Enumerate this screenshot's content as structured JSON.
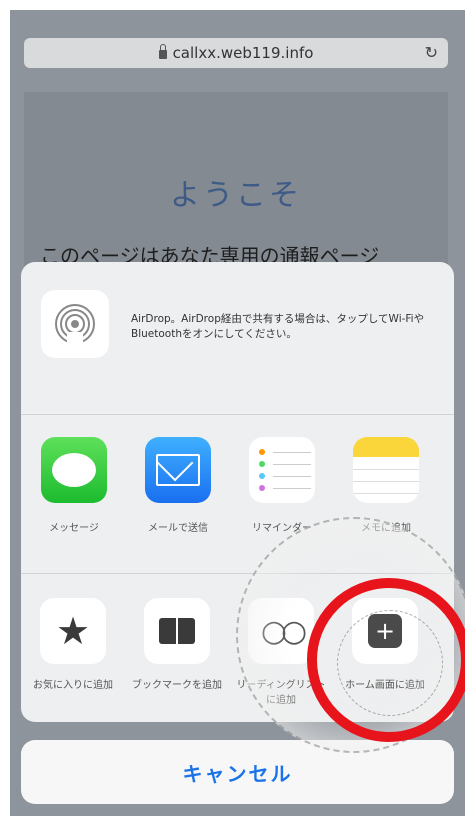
{
  "browser": {
    "url": "callxx.web119.info",
    "reload_icon": "refresh-icon"
  },
  "page": {
    "heading": "ようこそ",
    "subtitle": "このページはあなた専用の通報ページ"
  },
  "share_sheet": {
    "airdrop": {
      "icon": "airdrop-icon",
      "text": "AirDrop。AirDrop経由で共有する場合は、タップしてWi-FiやBluetoothをオンにしてください。"
    },
    "apps": [
      {
        "label": "メッセージ",
        "icon": "messages-icon"
      },
      {
        "label": "メールで送信",
        "icon": "mail-icon"
      },
      {
        "label": "リマインダー",
        "icon": "reminders-icon"
      },
      {
        "label": "メモに追加",
        "icon": "notes-icon"
      }
    ],
    "actions": [
      {
        "label": "お気に入りに追加",
        "icon": "star-icon"
      },
      {
        "label": "ブックマークを追加",
        "icon": "book-icon"
      },
      {
        "label": "リーディングリストに追加",
        "icon": "glasses-icon"
      },
      {
        "label": "ホーム画面に追加",
        "icon": "plus-square-icon"
      }
    ],
    "cancel_label": "キャンセル"
  },
  "colors": {
    "highlight_circle": "#e8141b",
    "cancel_text": "#1a73e8"
  }
}
